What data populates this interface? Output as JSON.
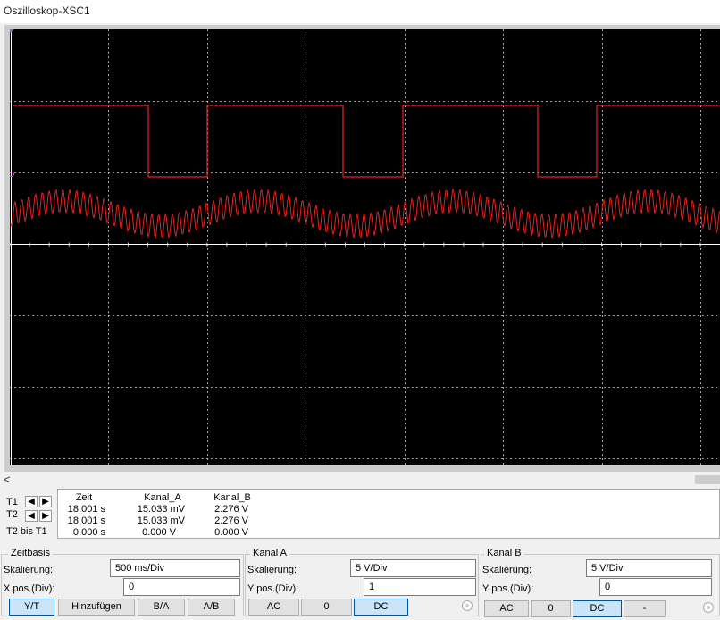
{
  "window": {
    "title": "Oszilloskop-XSC1"
  },
  "colors": {
    "trace_a": "#e8231f",
    "grid": "#cfcfcf",
    "screen": "#000000"
  },
  "scroll": {
    "left_arrow": "<"
  },
  "cursors": {
    "t1_label": "T1",
    "t2_label": "T2",
    "diff_label": "T2 bis T1",
    "headers": [
      "Zeit",
      "Kanal_A",
      "Kanal_B"
    ],
    "t1": [
      "18.001 s",
      "15.033 mV",
      "2.276 V"
    ],
    "t2": [
      "18.001 s",
      "15.033 mV",
      "2.276 V"
    ],
    "diff": [
      "0.000 s",
      "0.000 V",
      "0.000 V"
    ]
  },
  "zeitbasis": {
    "title": "Zeitbasis",
    "scale_label": "Skalierung:",
    "scale_value": "500 ms/Div",
    "pos_label": "X pos.(Div):",
    "pos_value": "0",
    "buttons": [
      "Y/T",
      "Hinzufügen",
      "B/A",
      "A/B"
    ]
  },
  "kanal_a": {
    "title": "Kanal A",
    "scale_label": "Skalierung:",
    "scale_value": "5  V/Div",
    "pos_label": "Y pos.(Div):",
    "pos_value": "1",
    "buttons": [
      "AC",
      "0",
      "DC"
    ]
  },
  "kanal_b": {
    "title": "Kanal B",
    "scale_label": "Skalierung:",
    "scale_value": "5  V/Div",
    "pos_label": "Y pos.(Div):",
    "pos_value": "0",
    "buttons": [
      "AC",
      "0",
      "DC",
      "-"
    ]
  }
}
